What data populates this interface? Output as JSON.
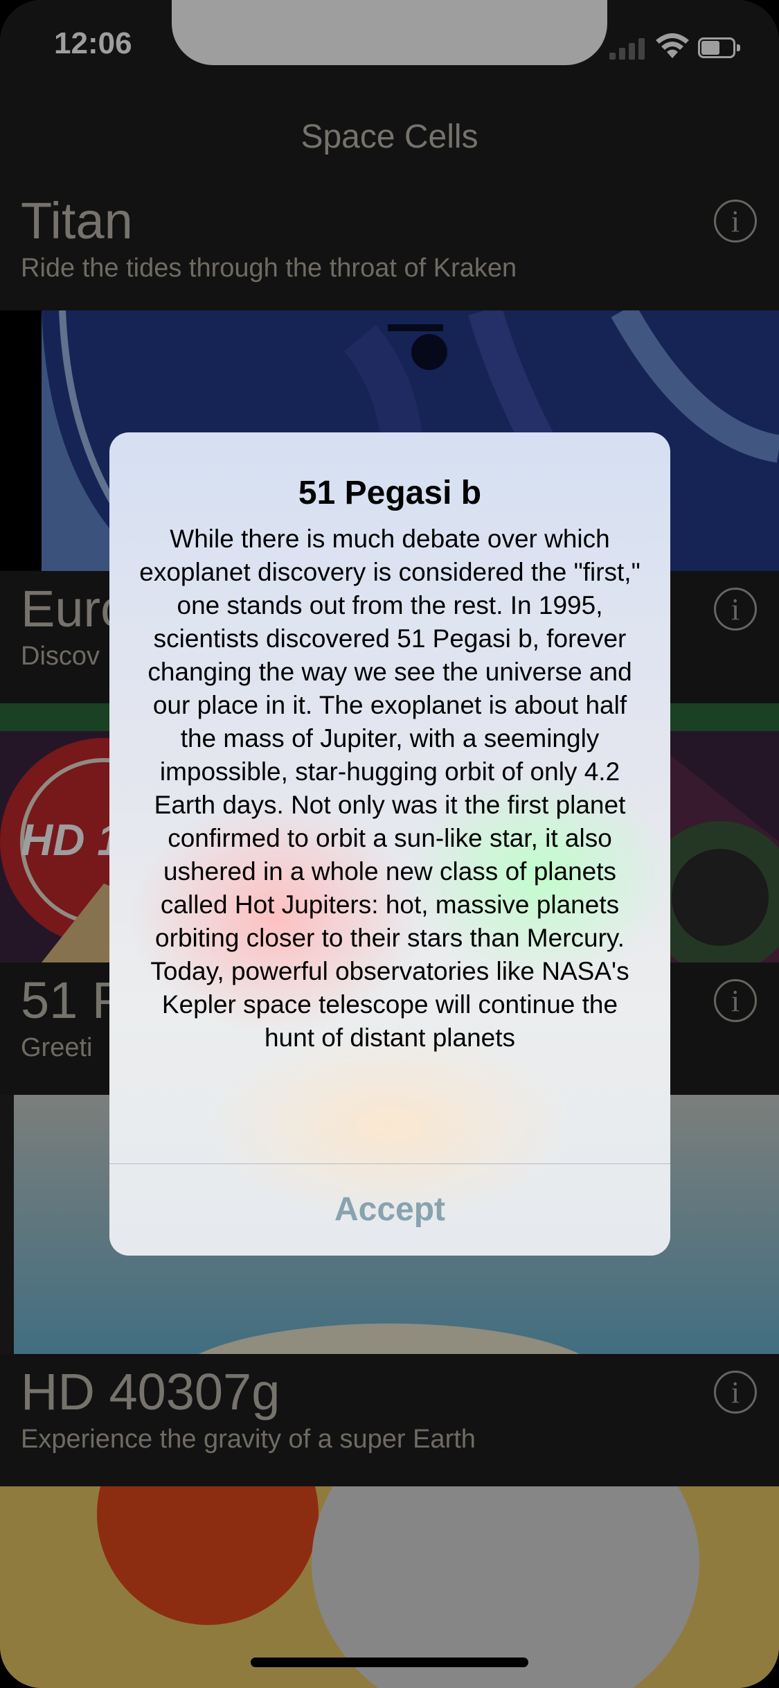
{
  "status_bar": {
    "time": "12:06"
  },
  "nav": {
    "title": "Space Cells"
  },
  "cells": [
    {
      "title": "Titan",
      "subtitle": "Ride the tides through the throat of Kraken",
      "info": "i"
    },
    {
      "title": "Euro",
      "subtitle": "Discov",
      "info": "i"
    },
    {
      "title": "51 P",
      "subtitle": "Greeti",
      "info": "i"
    },
    {
      "title": "HD 40307g",
      "subtitle": "Experience the gravity of a super Earth",
      "info": "i"
    }
  ],
  "alert": {
    "title": "51 Pegasi b",
    "message": "While there is much debate over which exoplanet discovery is considered the \"first,\" one stands out from the rest. In 1995, scientists discovered 51 Pegasi b, forever changing the way we see the universe and our place in it. The exoplanet is about half the mass of Jupiter, with a seemingly impossible, star-hugging orbit of only 4.2 Earth days. Not only was it the first planet confirmed to orbit a sun-like star, it also ushered in a whole new class of planets called Hot Jupiters: hot, massive planets orbiting closer to their stars than Mercury. Today, powerful observatories like NASA's Kepler space telescope will continue the hunt of distant planets",
    "accept_label": "Accept"
  },
  "art_labels": {
    "hd_badge": "HD 1"
  },
  "colors": {
    "background": "#2b2b2b",
    "accent_button": "#87a3b0"
  }
}
